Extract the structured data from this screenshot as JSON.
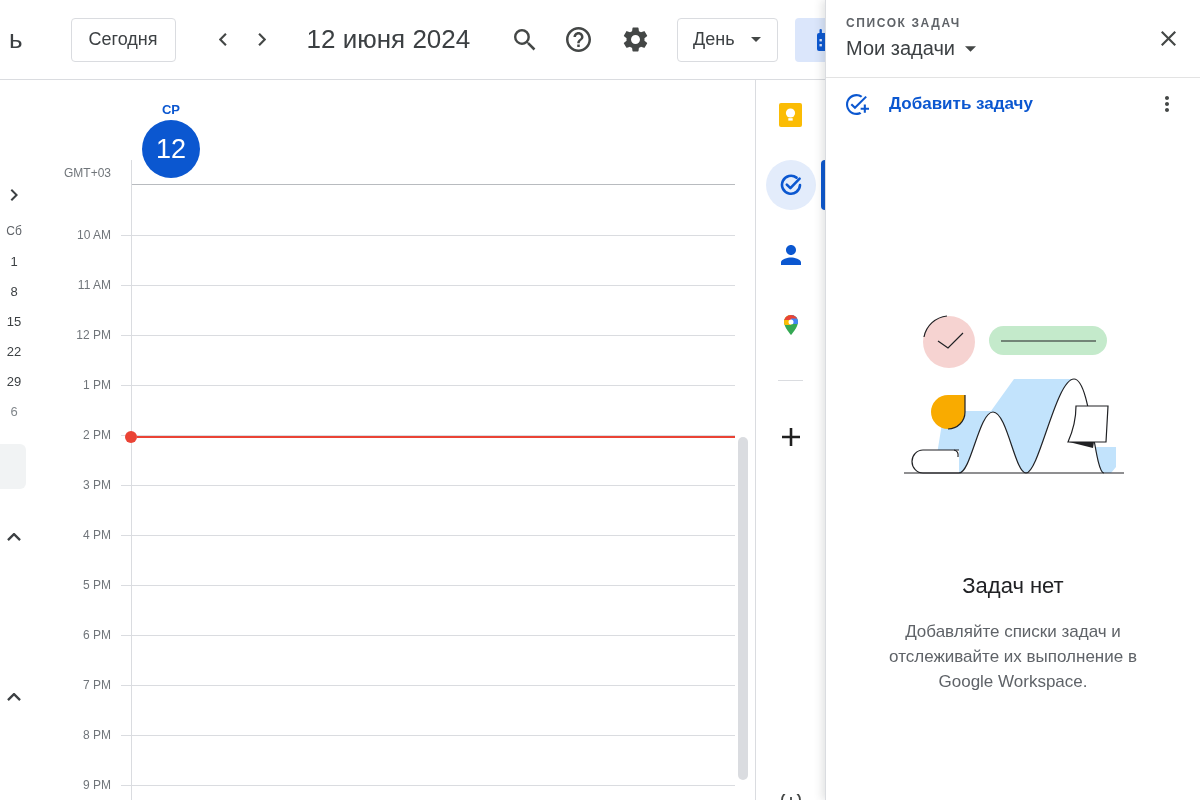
{
  "header": {
    "app_title": "ь",
    "today_button": "Сегодня",
    "date_title": "12 июня 2024",
    "view_select": "День"
  },
  "mini_calendar": {
    "weekday": "Сб",
    "days": [
      {
        "label": "1",
        "outside_month": false
      },
      {
        "label": "8",
        "outside_month": false
      },
      {
        "label": "15",
        "outside_month": false
      },
      {
        "label": "22",
        "outside_month": false
      },
      {
        "label": "29",
        "outside_month": false
      },
      {
        "label": "6",
        "outside_month": true
      }
    ]
  },
  "sidebar_sections": [
    {
      "expanded": true
    },
    {
      "expanded": true
    }
  ],
  "day_header": {
    "timezone": "GMT+03",
    "weekday": "СР",
    "date": "12",
    "today": true
  },
  "hours": [
    {
      "label": "10 AM",
      "current": false
    },
    {
      "label": "11 AM",
      "current": false
    },
    {
      "label": "12 PM",
      "current": false
    },
    {
      "label": "1 PM",
      "current": false
    },
    {
      "label": "2 PM",
      "current": true
    },
    {
      "label": "3 PM",
      "current": false
    },
    {
      "label": "4 PM",
      "current": false
    },
    {
      "label": "5 PM",
      "current": false
    },
    {
      "label": "6 PM",
      "current": false
    },
    {
      "label": "7 PM",
      "current": false
    },
    {
      "label": "8 PM",
      "current": false
    },
    {
      "label": "9 PM",
      "current": false
    }
  ],
  "side_apps": [
    {
      "selected": false
    },
    {
      "selected": true
    },
    {
      "selected": false
    },
    {
      "selected": false
    }
  ],
  "tasks_panel": {
    "overline": "СПИСОК ЗАДАЧ",
    "list_name": "Мои задачи",
    "add_task": "Добавить задачу",
    "empty_title": "Задач нет",
    "empty_text": "Добавляйте списки задач и отслеживайте их выполнение в Google Workspace."
  }
}
